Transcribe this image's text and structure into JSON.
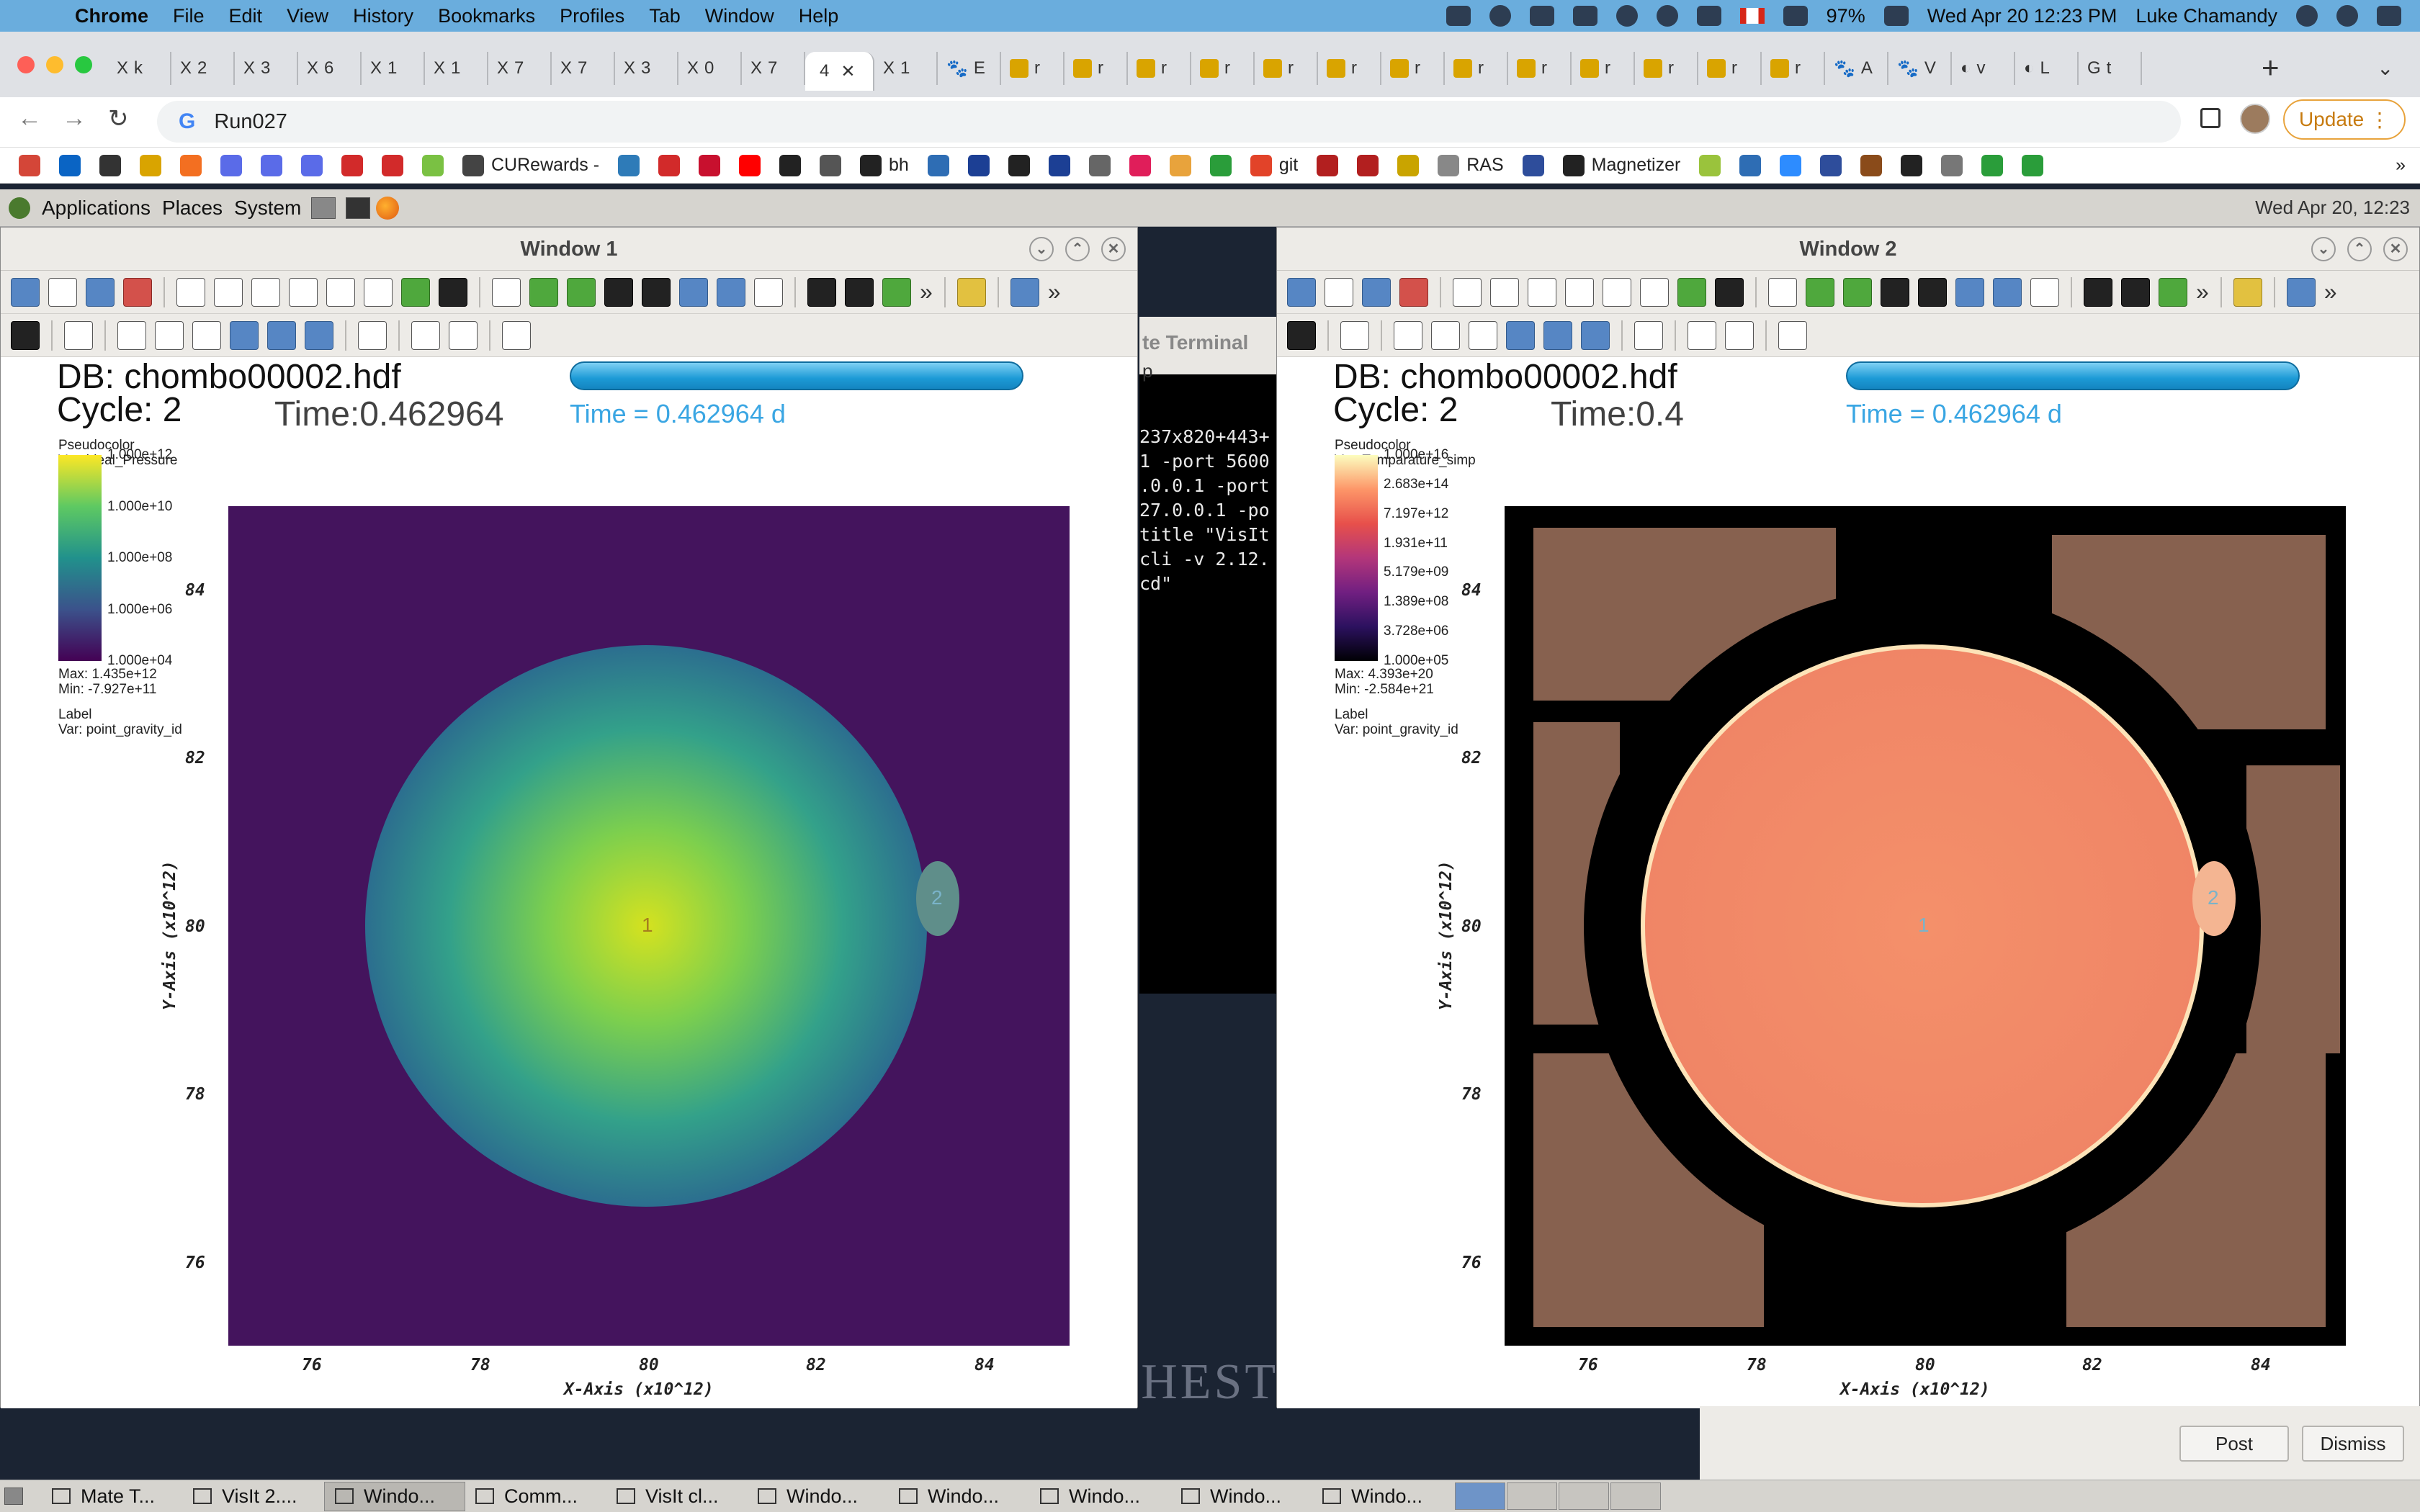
{
  "menubar": {
    "apple": "",
    "app": "Chrome",
    "items": [
      "File",
      "Edit",
      "View",
      "History",
      "Bookmarks",
      "Profiles",
      "Tab",
      "Window",
      "Help"
    ],
    "battery": "97%",
    "datetime": "Wed Apr 20  12:23 PM",
    "user": "Luke Chamandy"
  },
  "tabs": [
    {
      "fav": "X",
      "label": "k"
    },
    {
      "fav": "X",
      "label": "2"
    },
    {
      "fav": "X",
      "label": "3"
    },
    {
      "fav": "X",
      "label": "6"
    },
    {
      "fav": "X",
      "label": "1"
    },
    {
      "fav": "X",
      "label": "1"
    },
    {
      "fav": "X",
      "label": "7"
    },
    {
      "fav": "X",
      "label": "7"
    },
    {
      "fav": "X",
      "label": "3"
    },
    {
      "fav": "X",
      "label": "0"
    },
    {
      "fav": "X",
      "label": "7"
    },
    {
      "fav": "",
      "label": "4",
      "active": true
    },
    {
      "fav": "X",
      "label": "1"
    },
    {
      "fav": "paw",
      "label": "E"
    },
    {
      "fav": "visit",
      "label": "r"
    },
    {
      "fav": "visit",
      "label": "r"
    },
    {
      "fav": "visit",
      "label": "r"
    },
    {
      "fav": "visit",
      "label": "r"
    },
    {
      "fav": "visit",
      "label": "r"
    },
    {
      "fav": "visit",
      "label": "r"
    },
    {
      "fav": "visit",
      "label": "r"
    },
    {
      "fav": "visit",
      "label": "r"
    },
    {
      "fav": "visit",
      "label": "r"
    },
    {
      "fav": "visit",
      "label": "r"
    },
    {
      "fav": "visit",
      "label": "r"
    },
    {
      "fav": "visit",
      "label": "r"
    },
    {
      "fav": "visit",
      "label": "r"
    },
    {
      "fav": "paw",
      "label": "A"
    },
    {
      "fav": "paw",
      "label": "V"
    },
    {
      "fav": "globe",
      "label": "v"
    },
    {
      "fav": "globe",
      "label": "L"
    },
    {
      "fav": "G",
      "label": "t"
    }
  ],
  "omnibox": {
    "g": "G",
    "value": "Run027"
  },
  "update_label": "Update",
  "bookmarks": [
    {
      "color": "#d44638",
      "label": ""
    },
    {
      "color": "#0a64c4",
      "label": ""
    },
    {
      "color": "#333333",
      "label": ""
    },
    {
      "color": "#d9a400",
      "label": ""
    },
    {
      "color": "#f36f21",
      "label": ""
    },
    {
      "color": "#5a6be8",
      "label": ""
    },
    {
      "color": "#5a6be8",
      "label": ""
    },
    {
      "color": "#5a6be8",
      "label": ""
    },
    {
      "color": "#d22a2a",
      "label": ""
    },
    {
      "color": "#d22a2a",
      "label": ""
    },
    {
      "color": "#7ac143",
      "label": ""
    },
    {
      "color": "#444444",
      "label": "CURewards -"
    },
    {
      "color": "#2e7bb8",
      "label": ""
    },
    {
      "color": "#d22a2a",
      "label": ""
    },
    {
      "color": "#c8102e",
      "label": ""
    },
    {
      "color": "#ff0000",
      "label": ""
    },
    {
      "color": "#222222",
      "label": ""
    },
    {
      "color": "#555555",
      "label": ""
    },
    {
      "color": "#222222",
      "label": "bh"
    },
    {
      "color": "#2e6db4",
      "label": ""
    },
    {
      "color": "#1c3f94",
      "label": ""
    },
    {
      "color": "#222222",
      "label": ""
    },
    {
      "color": "#1c3f94",
      "label": ""
    },
    {
      "color": "#666666",
      "label": ""
    },
    {
      "color": "#e01e5a",
      "label": ""
    },
    {
      "color": "#e8a33c",
      "label": ""
    },
    {
      "color": "#2a9d3a",
      "label": ""
    },
    {
      "color": "#e24329",
      "label": "git"
    },
    {
      "color": "#b21f1f",
      "label": ""
    },
    {
      "color": "#b21f1f",
      "label": ""
    },
    {
      "color": "#c9a400",
      "label": ""
    },
    {
      "color": "#888888",
      "label": "RAS"
    },
    {
      "color": "#2e4d9b",
      "label": ""
    },
    {
      "color": "#222222",
      "label": "Magnetizer"
    },
    {
      "color": "#9ac33c",
      "label": ""
    },
    {
      "color": "#2e6db4",
      "label": ""
    },
    {
      "color": "#2d8cff",
      "label": ""
    },
    {
      "color": "#2e4d9b",
      "label": ""
    },
    {
      "color": "#8a4b1a",
      "label": ""
    },
    {
      "color": "#222222",
      "label": ""
    },
    {
      "color": "#777777",
      "label": ""
    },
    {
      "color": "#2a9d3a",
      "label": ""
    },
    {
      "color": "#2a9d3a",
      "label": ""
    }
  ],
  "gnome": {
    "applications": "Applications",
    "places": "Places",
    "system": "System",
    "clock": "Wed Apr 20, 12:23"
  },
  "terminal": {
    "title": "te Terminal",
    "sub": "p",
    "lines": [
      "237x820+443+",
      "1 -port 5600",
      ".0.0.1 -port",
      "27.0.0.1 -po",
      "title \"VisIt",
      "cli -v 2.12.",
      "cd\""
    ]
  },
  "background_text": "SITY of ROCHESTER",
  "windows": [
    {
      "title": "Window 1",
      "db": "DB: chombo00002.hdf",
      "cycle": "Cycle: 2",
      "faded_time": "Time:0.462964",
      "time": "Time = 0.462964 d",
      "legend": {
        "plot": "Pseudocolor",
        "var": "Var: ideal_Pressure",
        "ticks": [
          "1.000e+12",
          "1.000e+10",
          "1.000e+08",
          "1.000e+06",
          "1.000e+04"
        ],
        "max": "Max:  1.435e+12",
        "min": "Min: -7.927e+11",
        "label": "Label",
        "label_var": "Var: point_gravity_id",
        "colors": [
          "#fde725",
          "#5ec962",
          "#21918c",
          "#3b528b",
          "#440154"
        ]
      },
      "xticks": [
        "76",
        "78",
        "80",
        "82",
        "84"
      ],
      "yticks": [
        "84",
        "82",
        "80",
        "78",
        "76"
      ],
      "xlabel": "X-Axis (x10^12)",
      "ylabel": "Y-Axis (x10^12)",
      "point_labels": [
        "1",
        "2"
      ]
    },
    {
      "title": "Window 2",
      "db": "DB: chombo00002.hdf",
      "cycle": "Cycle: 2",
      "faded_time": "Time:0.4",
      "time": "Time = 0.462964 d",
      "legend": {
        "plot": "Pseudocolor",
        "var": "Var: Temparature_simp",
        "ticks": [
          "1.000e+16",
          "2.683e+14",
          "7.197e+12",
          "1.931e+11",
          "5.179e+09",
          "1.389e+08",
          "3.728e+06",
          "1.000e+05"
        ],
        "max": "Max:  4.393e+20",
        "min": "Min: -2.584e+21",
        "label": "Label",
        "label_var": "Var: point_gravity_id",
        "colors": [
          "#fcfdbf",
          "#fd9668",
          "#e7504b",
          "#b3367a",
          "#711f81",
          "#2c115f",
          "#000004"
        ]
      },
      "xticks": [
        "76",
        "78",
        "80",
        "82",
        "84"
      ],
      "yticks": [
        "84",
        "82",
        "80",
        "78",
        "76"
      ],
      "xlabel": "X-Axis (x10^12)",
      "ylabel": "Y-Axis (x10^12)",
      "point_labels": [
        "1",
        "2"
      ]
    }
  ],
  "dialog_buttons": {
    "post": "Post",
    "dismiss": "Dismiss"
  },
  "taskbar": [
    {
      "label": "Mate T..."
    },
    {
      "label": "VisIt 2...."
    },
    {
      "label": "Windo...",
      "active": true
    },
    {
      "label": "Comm..."
    },
    {
      "label": "VisIt cl..."
    },
    {
      "label": "Windo..."
    },
    {
      "label": "Windo..."
    },
    {
      "label": "Windo..."
    },
    {
      "label": "Windo..."
    },
    {
      "label": "Windo..."
    }
  ]
}
